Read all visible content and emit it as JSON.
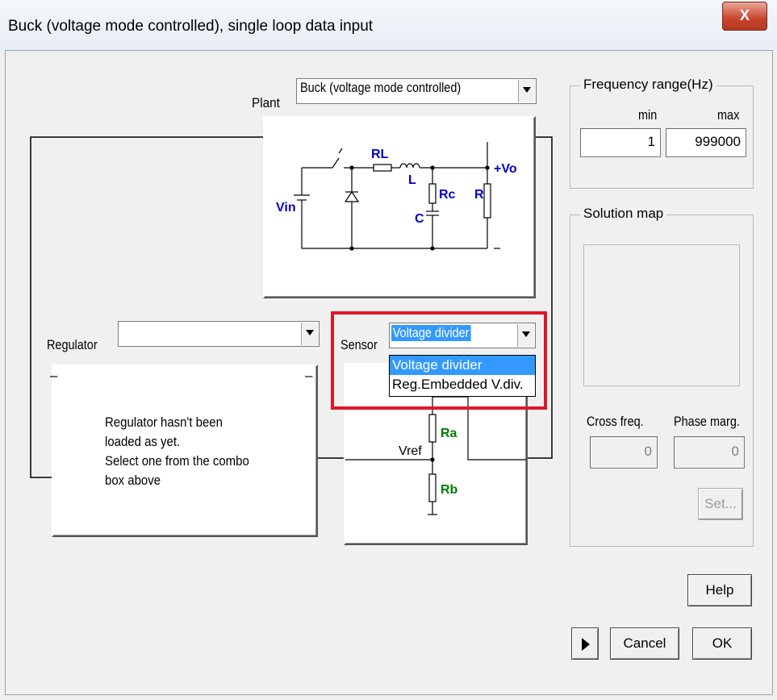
{
  "window": {
    "title": "Buck (voltage mode controlled), single loop data input",
    "close_label": "X"
  },
  "plant": {
    "label": "Plant",
    "selected": "Buck (voltage mode controlled)",
    "schematic_labels": {
      "rl": "RL",
      "l": "L",
      "vo": "+Vo",
      "vin": "Vin",
      "rc": "Rc",
      "r": "R",
      "c": "C",
      "minus": "–"
    }
  },
  "regulator": {
    "label": "Regulator",
    "selected": "",
    "message": [
      "Regulator hasn't been",
      "loaded as yet.",
      "Select one from the combo",
      "box above"
    ],
    "corner_minus": "–"
  },
  "sensor": {
    "label": "Sensor",
    "selected": "Voltage divider",
    "options": [
      "Voltage divider",
      "Reg.Embedded V.div."
    ],
    "schematic_labels": {
      "ra": "Ra",
      "rb": "Rb",
      "vref": "Vref"
    }
  },
  "frequency_range": {
    "title": "Frequency range(Hz)",
    "min_label": "min",
    "max_label": "max",
    "min_value": "1",
    "max_value": "999000"
  },
  "solution_map": {
    "title": "Solution map",
    "cross_freq_label": "Cross freq.",
    "phase_marg_label": "Phase marg.",
    "cross_freq_value": "0",
    "phase_marg_value": "0",
    "set_label": "Set..."
  },
  "buttons": {
    "help": "Help",
    "cancel": "Cancel",
    "ok": "OK"
  },
  "colors": {
    "label_blue": "#0000cc",
    "label_green": "#007a00",
    "highlight_red": "#e0162b",
    "selection_blue": "#3399ff"
  }
}
